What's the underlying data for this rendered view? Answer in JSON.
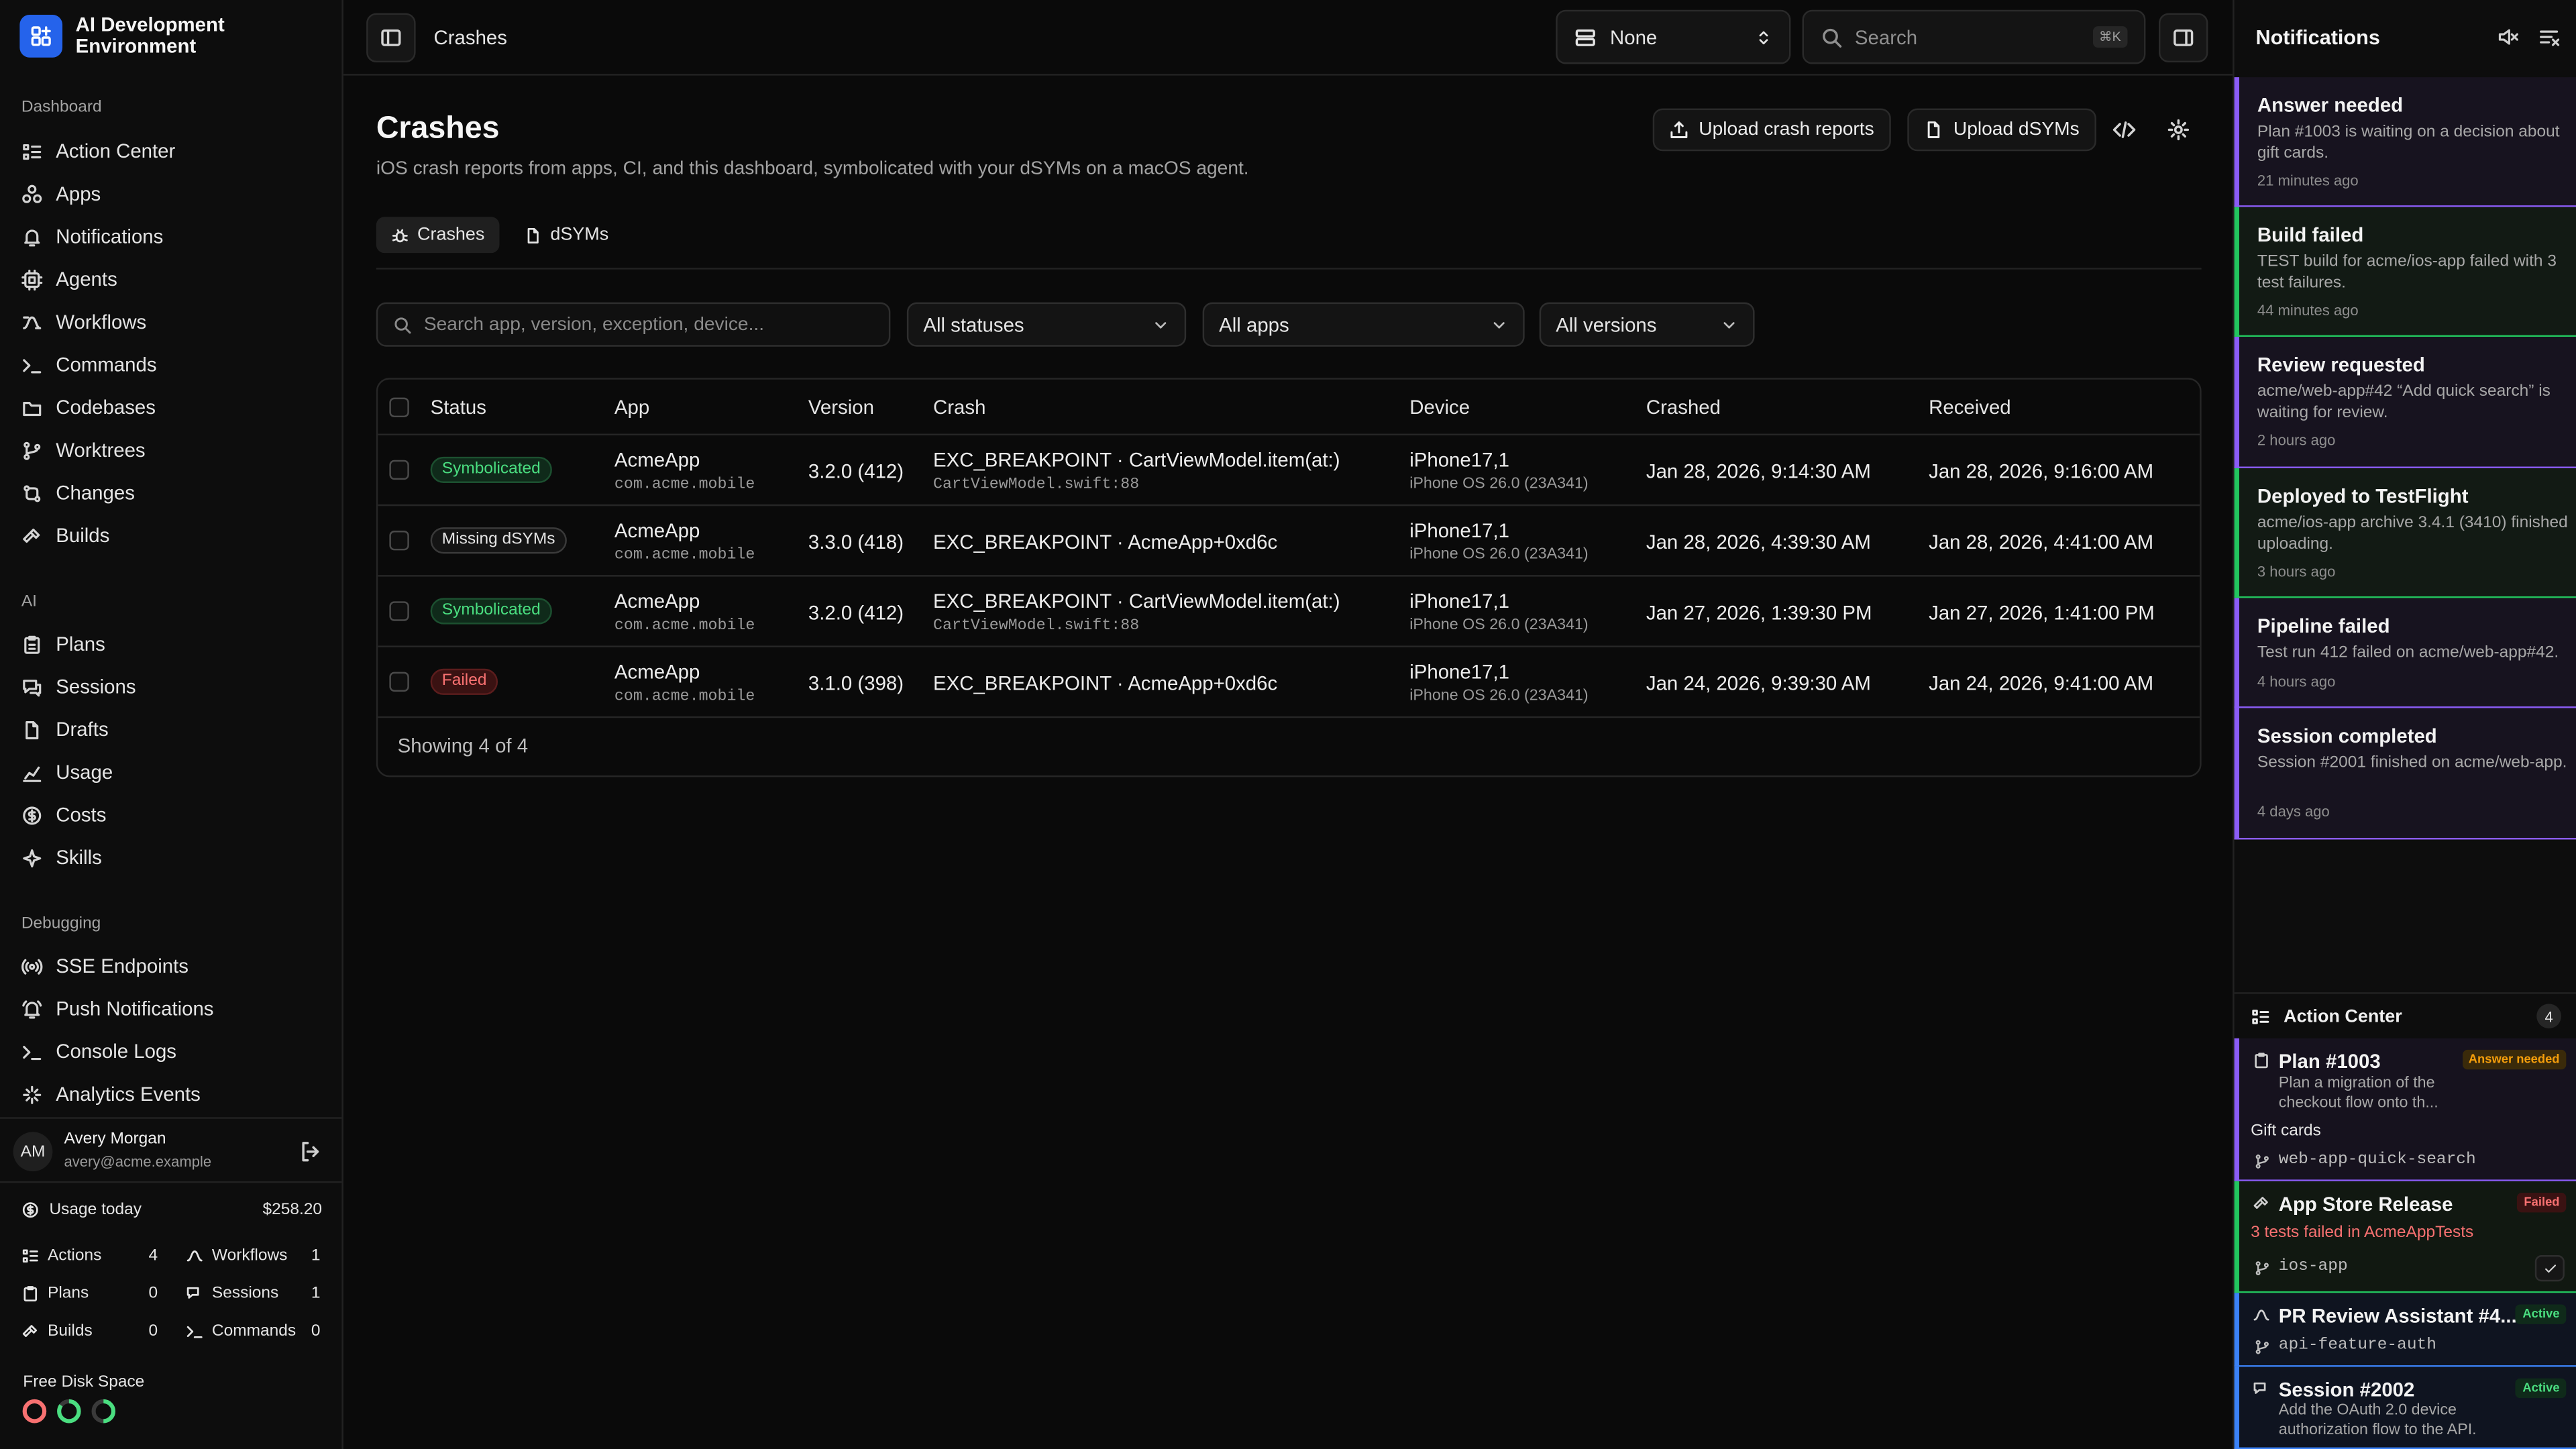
{
  "app": {
    "name": "AI Development Environment"
  },
  "sidebar": {
    "sections": [
      {
        "label": "Dashboard",
        "items": [
          {
            "label": "Action Center",
            "icon": "list-check-icon"
          },
          {
            "label": "Apps",
            "icon": "apps-icon"
          },
          {
            "label": "Notifications",
            "icon": "bell-icon"
          },
          {
            "label": "Agents",
            "icon": "cpu-icon"
          },
          {
            "label": "Workflows",
            "icon": "workflow-icon"
          },
          {
            "label": "Commands",
            "icon": "terminal-icon"
          },
          {
            "label": "Codebases",
            "icon": "folder-icon"
          },
          {
            "label": "Worktrees",
            "icon": "git-branch-icon"
          },
          {
            "label": "Changes",
            "icon": "git-compare-icon"
          },
          {
            "label": "Builds",
            "icon": "hammer-icon"
          }
        ]
      },
      {
        "label": "AI",
        "items": [
          {
            "label": "Plans",
            "icon": "clipboard-icon"
          },
          {
            "label": "Sessions",
            "icon": "chat-icon"
          },
          {
            "label": "Drafts",
            "icon": "file-icon"
          },
          {
            "label": "Usage",
            "icon": "chart-icon"
          },
          {
            "label": "Costs",
            "icon": "dollar-icon"
          },
          {
            "label": "Skills",
            "icon": "sparkle-icon"
          }
        ]
      },
      {
        "label": "Debugging",
        "items": [
          {
            "label": "SSE Endpoints",
            "icon": "radio-icon"
          },
          {
            "label": "Push Notifications",
            "icon": "bell-ring-icon"
          },
          {
            "label": "Console Logs",
            "icon": "terminal-icon"
          },
          {
            "label": "Analytics Events",
            "icon": "activity-icon"
          }
        ]
      }
    ],
    "user": {
      "initials": "AM",
      "name": "Avery Morgan",
      "email": "avery@acme.example"
    },
    "usage": {
      "label": "Usage today",
      "amount": "$258.20",
      "stats": [
        {
          "label": "Actions",
          "value": "4"
        },
        {
          "label": "Workflows",
          "value": "1"
        },
        {
          "label": "Plans",
          "value": "0"
        },
        {
          "label": "Sessions",
          "value": "1"
        },
        {
          "label": "Builds",
          "value": "0"
        },
        {
          "label": "Commands",
          "value": "0"
        }
      ]
    },
    "disk": {
      "label": "Free Disk Space",
      "rings": [
        {
          "color": "#f87171",
          "fraction": 1.0
        },
        {
          "color": "#4ade80",
          "fraction": 0.85
        },
        {
          "color": "#4ade80",
          "fraction": 0.5
        }
      ]
    }
  },
  "topbar": {
    "breadcrumb": "Crashes",
    "env_select": "None",
    "search_placeholder": "Search",
    "search_kbd": "⌘K"
  },
  "main": {
    "title": "Crashes",
    "subtitle": "iOS crash reports from apps, CI, and this dashboard, symbolicated with your dSYMs on a macOS agent.",
    "actions": {
      "upload_crash": "Upload crash reports",
      "upload_dsyms": "Upload dSYMs"
    },
    "tabs": [
      {
        "label": "Crashes",
        "active": true
      },
      {
        "label": "dSYMs",
        "active": false
      }
    ],
    "filters": {
      "search_placeholder": "Search app, version, exception, device...",
      "status": "All statuses",
      "app": "All apps",
      "version": "All versions"
    },
    "table": {
      "columns": [
        "Status",
        "App",
        "Version",
        "Crash",
        "Device",
        "Crashed",
        "Received"
      ],
      "rows": [
        {
          "status": "Symbolicated",
          "status_kind": "sym",
          "app": "AcmeApp",
          "bundle": "com.acme.mobile",
          "version": "3.2.0 (412)",
          "crash": "EXC_BREAKPOINT · CartViewModel.item(at:)",
          "crash_loc": "CartViewModel.swift:88",
          "device": "iPhone17,1",
          "os": "iPhone OS 26.0 (23A341)",
          "crashed": "Jan 28, 2026, 9:14:30 AM",
          "received": "Jan 28, 2026, 9:16:00 AM"
        },
        {
          "status": "Missing dSYMs",
          "status_kind": "miss",
          "app": "AcmeApp",
          "bundle": "com.acme.mobile",
          "version": "3.3.0 (418)",
          "crash": "EXC_BREAKPOINT · AcmeApp+0xd6c",
          "crash_loc": "",
          "device": "iPhone17,1",
          "os": "iPhone OS 26.0 (23A341)",
          "crashed": "Jan 28, 2026, 4:39:30 AM",
          "received": "Jan 28, 2026, 4:41:00 AM"
        },
        {
          "status": "Symbolicated",
          "status_kind": "sym",
          "app": "AcmeApp",
          "bundle": "com.acme.mobile",
          "version": "3.2.0 (412)",
          "crash": "EXC_BREAKPOINT · CartViewModel.item(at:)",
          "crash_loc": "CartViewModel.swift:88",
          "device": "iPhone17,1",
          "os": "iPhone OS 26.0 (23A341)",
          "crashed": "Jan 27, 2026, 1:39:30 PM",
          "received": "Jan 27, 2026, 1:41:00 PM"
        },
        {
          "status": "Failed",
          "status_kind": "fail",
          "app": "AcmeApp",
          "bundle": "com.acme.mobile",
          "version": "3.1.0 (398)",
          "crash": "EXC_BREAKPOINT · AcmeApp+0xd6c",
          "crash_loc": "",
          "device": "iPhone17,1",
          "os": "iPhone OS 26.0 (23A341)",
          "crashed": "Jan 24, 2026, 9:39:30 AM",
          "received": "Jan 24, 2026, 9:41:00 AM"
        }
      ],
      "footer": "Showing 4 of 4"
    }
  },
  "notifications": {
    "title": "Notifications",
    "items": [
      {
        "title": "Answer needed",
        "body": "Plan #1003 is waiting on a decision about gift cards.",
        "time": "21 minutes ago",
        "color": "purple"
      },
      {
        "title": "Build failed",
        "body": "TEST build for acme/ios-app failed with 3 test failures.",
        "time": "44 minutes ago",
        "color": "green"
      },
      {
        "title": "Review requested",
        "body": "acme/web-app#42 “Add quick search” is waiting for review.",
        "time": "2 hours ago",
        "color": "purple"
      },
      {
        "title": "Deployed to TestFlight",
        "body": "acme/ios-app archive 3.4.1 (3410) finished uploading.",
        "time": "3 hours ago",
        "color": "green"
      },
      {
        "title": "Pipeline failed",
        "body": "Test run 412 failed on acme/web-app#42.",
        "time": "4 hours ago",
        "color": "purple"
      },
      {
        "title": "Session completed",
        "body": "Session #2001 finished on acme/web-app.",
        "time": "4 days ago",
        "color": "purple"
      }
    ]
  },
  "action_center": {
    "title": "Action Center",
    "count": "4",
    "items": [
      {
        "title": "Plan #1003",
        "badge": "Answer needed",
        "body": "Plan a migration of the checkout flow onto th...",
        "question": "Gift cards",
        "branch": "web-app-quick-search"
      },
      {
        "title": "App Store Release",
        "badge": "Failed",
        "body": "3 tests failed in AcmeAppTests",
        "branch": "ios-app"
      },
      {
        "title": "PR Review Assistant #4...",
        "badge": "Active",
        "branch": "api-feature-auth"
      },
      {
        "title": "Session #2002",
        "badge": "Active",
        "body": "Add the OAuth 2.0 device authorization flow to the API."
      }
    ]
  },
  "colors": {
    "accent": "#2563eb",
    "purple": "#8b5cf6",
    "green": "#22c55e",
    "red": "#ef4444",
    "amber": "#f59e0b"
  }
}
